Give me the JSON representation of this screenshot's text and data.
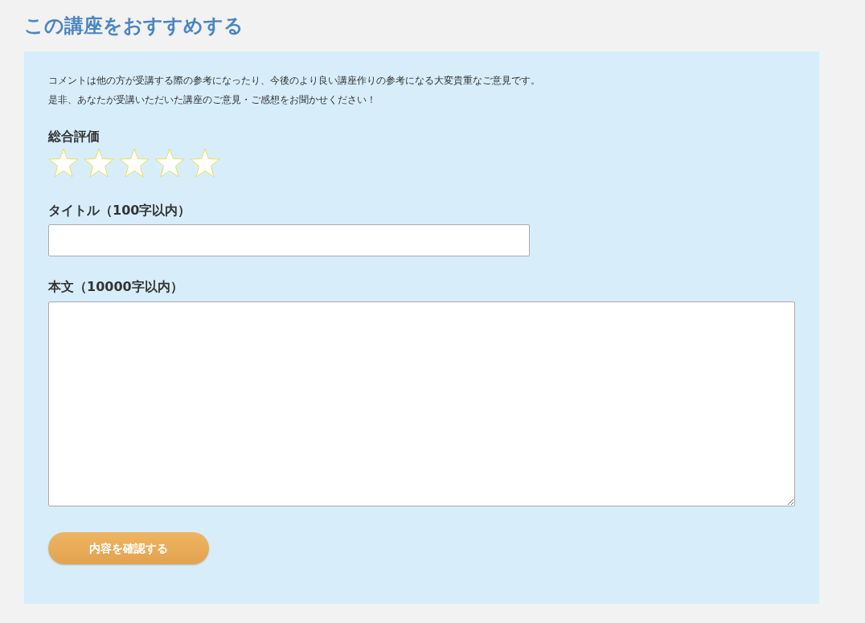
{
  "heading": "この講座をおすすめする",
  "intro": [
    "コメントは他の方が受講する際の参考になったり、今後のより良い講座作りの参考になる大変貴重なご意見です。",
    "是非、あなたが受講いただいた講座のご意見・ご感想をお聞かせください！"
  ],
  "rating": {
    "label": "総合評価",
    "stars": 0
  },
  "title_field": {
    "label": "タイトル（100字以内）"
  },
  "body_field": {
    "label": "本文（10000字以内）"
  },
  "submit_button": "内容を確認する"
}
